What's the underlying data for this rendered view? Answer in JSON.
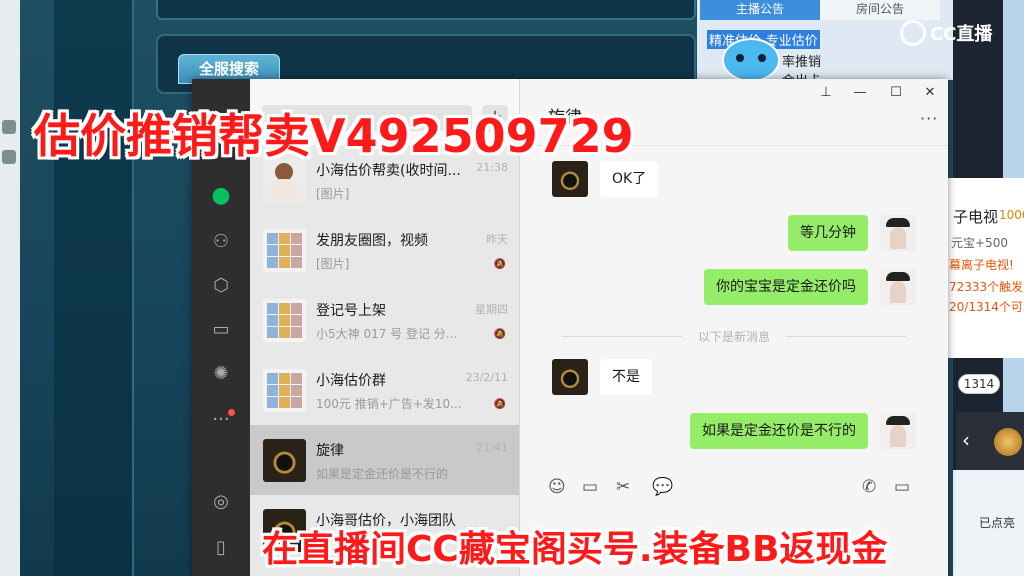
{
  "game": {
    "search_tab": "全服搜索"
  },
  "stream": {
    "tabs": [
      "主播公告",
      "房间公告"
    ],
    "notice_lines": [
      "精准估价-专业估价",
      "率推销",
      "金出卡"
    ],
    "logo": "CC直播",
    "side": {
      "tv_title": "子电视",
      "side_num": "1000",
      "line2": "元宝+500",
      "line3": "幕离子电视!",
      "line4": "72333个触发",
      "line5": "20/1314个可",
      "count": "1314",
      "bottom": "已点亮"
    }
  },
  "chat": {
    "list": [
      {
        "name": "小海估价帮卖(收时间...",
        "preview": "[图片]",
        "time": "21:38",
        "avatar": "girl",
        "muted": false
      },
      {
        "name": "发朋友圈图，视频",
        "preview": "[图片]",
        "time": "昨天",
        "avatar": "group",
        "muted": true
      },
      {
        "name": "登记号上架",
        "preview": "小5大神 017 号 登记 分...",
        "time": "星期四",
        "avatar": "group",
        "muted": true
      },
      {
        "name": "小海估价群",
        "preview": "100元 推销+广告+发10...",
        "time": "23/2/11",
        "avatar": "group",
        "muted": true
      },
      {
        "name": "旋律",
        "preview": "如果是定金还价是不行的",
        "time": "21:41",
        "avatar": "ring",
        "muted": false,
        "selected": true
      },
      {
        "name": "小海哥估价，小海团队",
        "preview": "",
        "time": "",
        "avatar": "ring",
        "muted": false
      }
    ],
    "conversation": {
      "title": "旋律",
      "messages": [
        {
          "dir": "in",
          "text": "OK了"
        },
        {
          "dir": "out",
          "text": "等几分钟"
        },
        {
          "dir": "out",
          "text": "你的宝宝是定金还价吗"
        },
        {
          "dir": "in",
          "text": "不是"
        },
        {
          "dir": "out",
          "text": "如果是定金还价是不行的"
        }
      ],
      "new_msg_divider": "以下是新消息"
    },
    "window_controls": [
      "pin-icon",
      "minimize-icon",
      "maximize-icon",
      "close-icon"
    ],
    "more": "···"
  },
  "overlay": {
    "top": "估价推销帮卖V492509729",
    "bottom": "在直播间CC藏宝阁买号.装备BB返现金"
  },
  "colors": {
    "accent": "#07c160",
    "out_bubble": "#95ec69",
    "banner": "#ff1a1a"
  }
}
